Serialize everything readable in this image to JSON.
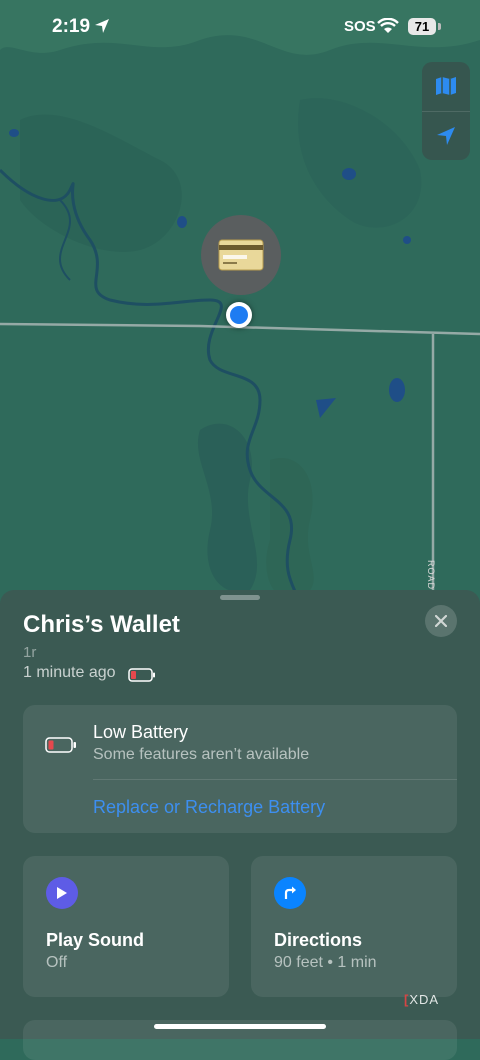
{
  "status_bar": {
    "time": "2:19",
    "carrier": "SOS",
    "battery": "71"
  },
  "map": {
    "road_label": "ROAD",
    "item_icon": "wallet-card",
    "map_button_icon": "map-icon",
    "locate_button_icon": "location-arrow-icon"
  },
  "sheet": {
    "title": "Chris’s Wallet",
    "subtitle": "1r",
    "updated": "1 minute ago",
    "low_battery": {
      "title": "Low Battery",
      "subtitle": "Some features aren’t available",
      "link": "Replace or Recharge Battery"
    },
    "actions": [
      {
        "title": "Play Sound",
        "subtitle": "Off",
        "icon": "play-icon",
        "color": "#5e5ce6"
      },
      {
        "title": "Directions",
        "subtitle": "90 feet • 1 min",
        "icon": "turn-right-icon",
        "color": "#0a84ff"
      }
    ]
  },
  "watermark": {
    "bracket": "[",
    "text": "XDA"
  },
  "colors": {
    "accent": "#3d8ff0",
    "battery_low": "#e5484d"
  }
}
